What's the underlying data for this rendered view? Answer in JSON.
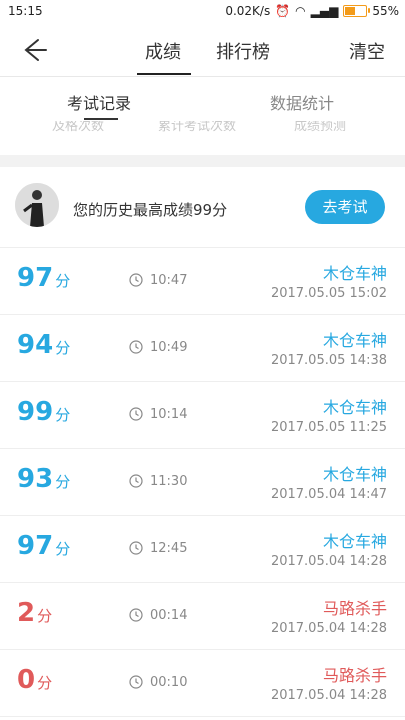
{
  "status_bar": {
    "time": "15:15",
    "speed": "0.02K/s",
    "battery": "55%"
  },
  "nav": {
    "tab_scores": "成绩",
    "tab_ranking": "排行榜",
    "clear": "清空"
  },
  "subtabs": {
    "records": "考试记录",
    "stats": "数据统计"
  },
  "stats_peek": [
    "及格次数",
    "累计考试次数",
    "成绩预测"
  ],
  "best": {
    "text": "您的历史最高成绩99分",
    "button": "去考试"
  },
  "unit": "分",
  "records": [
    {
      "score": "97",
      "duration": "10:47",
      "title": "木仓车神",
      "date": "2017.05.05",
      "time": "15:02",
      "color": "#27a8e0"
    },
    {
      "score": "94",
      "duration": "10:49",
      "title": "木仓车神",
      "date": "2017.05.05",
      "time": "14:38",
      "color": "#27a8e0"
    },
    {
      "score": "99",
      "duration": "10:14",
      "title": "木仓车神",
      "date": "2017.05.05",
      "time": "11:25",
      "color": "#27a8e0"
    },
    {
      "score": "93",
      "duration": "11:30",
      "title": "木仓车神",
      "date": "2017.05.04",
      "time": "14:47",
      "color": "#27a8e0"
    },
    {
      "score": "97",
      "duration": "12:45",
      "title": "木仓车神",
      "date": "2017.05.04",
      "time": "14:28",
      "color": "#27a8e0"
    },
    {
      "score": "2",
      "duration": "00:14",
      "title": "马路杀手",
      "date": "2017.05.04",
      "time": "14:28",
      "color": "#e05a5a"
    },
    {
      "score": "0",
      "duration": "00:10",
      "title": "马路杀手",
      "date": "2017.05.04",
      "time": "14:28",
      "color": "#e05a5a"
    }
  ]
}
